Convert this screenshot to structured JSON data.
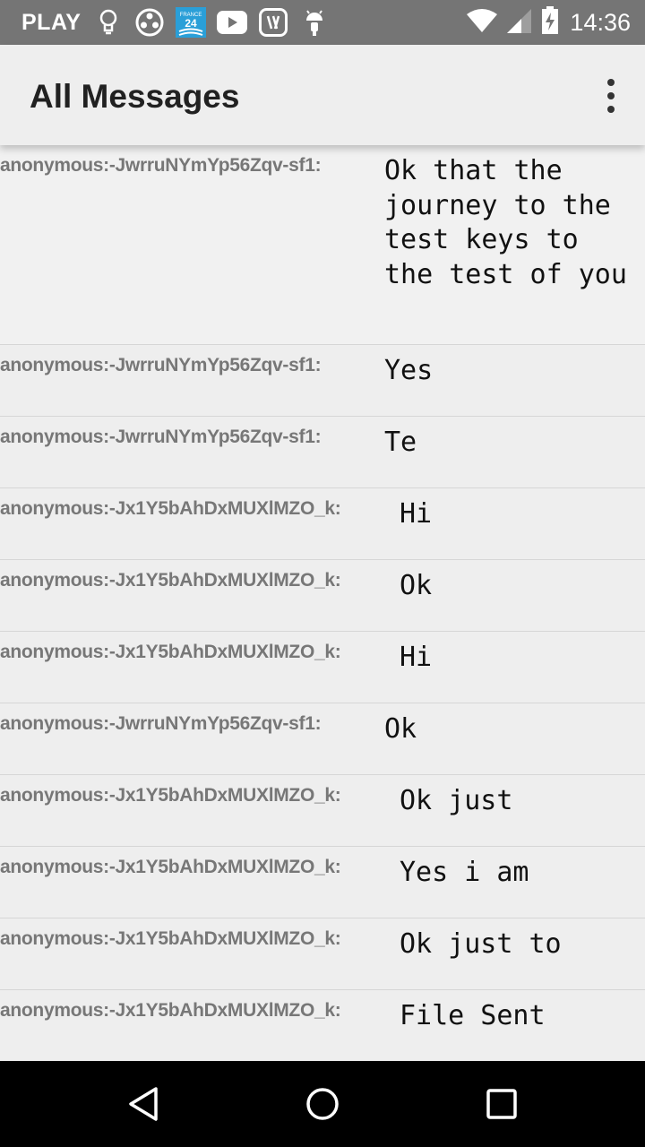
{
  "status_bar": {
    "carrier": "PLAY",
    "time": "14:36",
    "icons": [
      "lightbulb-icon",
      "film-reel-icon",
      "france24-icon",
      "youtube-icon",
      "saavn-icon",
      "android-icon",
      "wifi-icon",
      "signal-icon",
      "battery-icon"
    ]
  },
  "toolbar": {
    "title": "All Messages",
    "overflow_icon": "more-vert-icon"
  },
  "messages": [
    {
      "sender": "anonymous:-JwrruNYmYp56Zqv-sf1:",
      "text": "Ok that the journey to the test keys to the test of you"
    },
    {
      "sender": "anonymous:-JwrruNYmYp56Zqv-sf1:",
      "text": "Yes"
    },
    {
      "sender": "anonymous:-JwrruNYmYp56Zqv-sf1:",
      "text": "Te"
    },
    {
      "sender": "anonymous:-Jx1Y5bAhDxMUXlMZO_k:",
      "text": "Hi"
    },
    {
      "sender": "anonymous:-Jx1Y5bAhDxMUXlMZO_k:",
      "text": "Ok"
    },
    {
      "sender": "anonymous:-Jx1Y5bAhDxMUXlMZO_k:",
      "text": "Hi"
    },
    {
      "sender": "anonymous:-JwrruNYmYp56Zqv-sf1:",
      "text": "Ok"
    },
    {
      "sender": "anonymous:-Jx1Y5bAhDxMUXlMZO_k:",
      "text": "Ok just"
    },
    {
      "sender": "anonymous:-Jx1Y5bAhDxMUXlMZO_k:",
      "text": "Yes i am"
    },
    {
      "sender": "anonymous:-Jx1Y5bAhDxMUXlMZO_k:",
      "text": "Ok just to"
    },
    {
      "sender": "anonymous:-Jx1Y5bAhDxMUXlMZO_k:",
      "text": "File Sent"
    }
  ],
  "nav_bar": {
    "icons": [
      "back-icon",
      "home-icon",
      "recents-icon"
    ]
  }
}
